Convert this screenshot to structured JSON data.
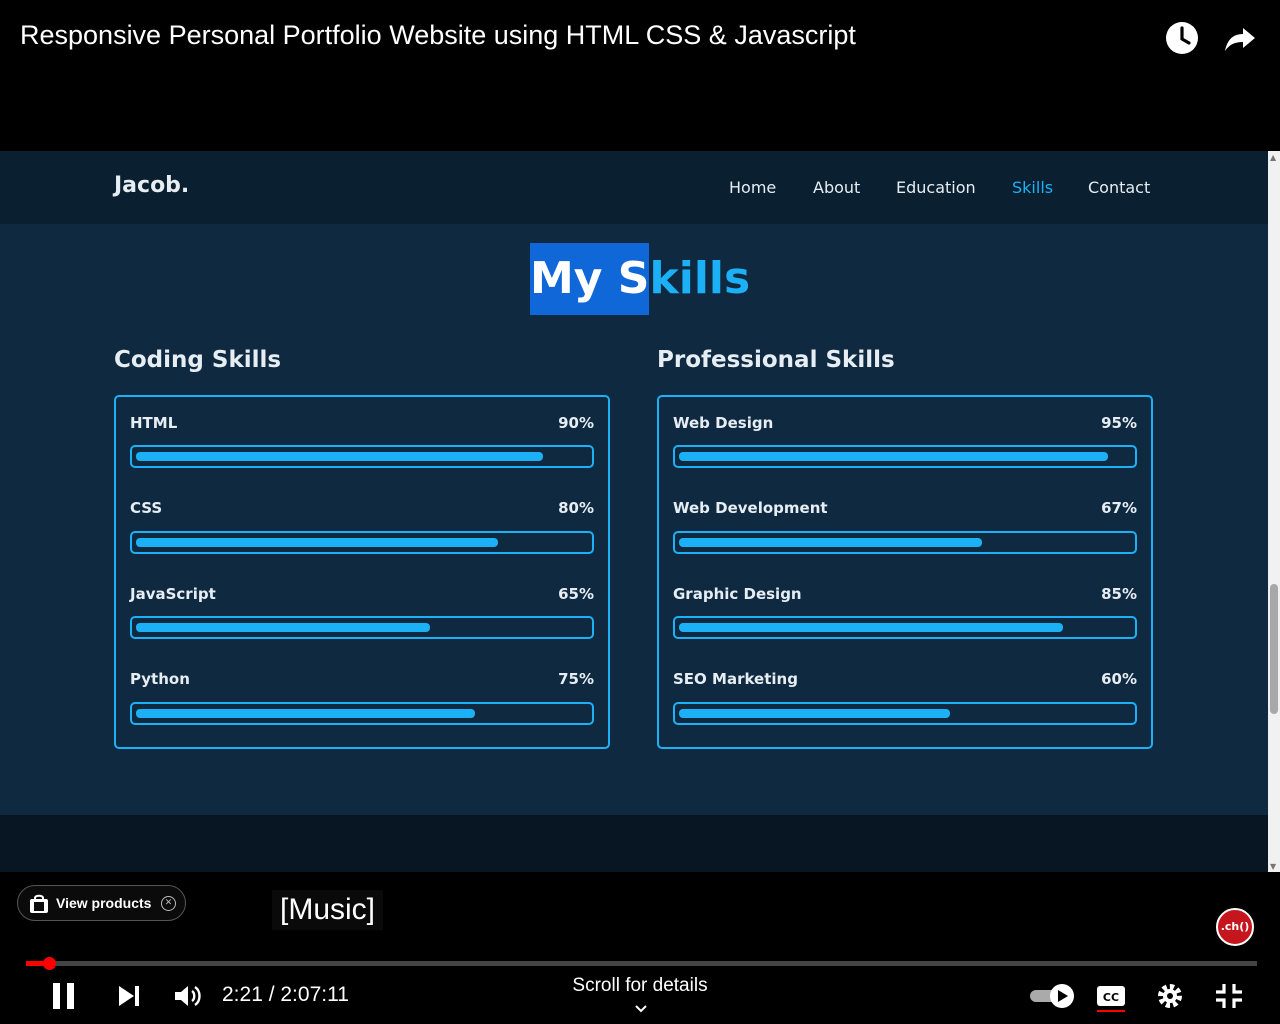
{
  "video": {
    "title": "Responsive Personal Portfolio Website using HTML CSS & Javascript"
  },
  "site": {
    "logo": "Jacob.",
    "nav": [
      {
        "label": "Home",
        "active": false
      },
      {
        "label": "About",
        "active": false
      },
      {
        "label": "Education",
        "active": false
      },
      {
        "label": "Skills",
        "active": true
      },
      {
        "label": "Contact",
        "active": false
      }
    ],
    "heading_selected": "My S",
    "heading_rest": "kills",
    "coding": {
      "title": "Coding Skills",
      "skills": [
        {
          "name": "HTML",
          "percent_label": "90%",
          "percent": 90
        },
        {
          "name": "CSS",
          "percent_label": "80%",
          "percent": 80
        },
        {
          "name": "JavaScript",
          "percent_label": "65%",
          "percent": 65
        },
        {
          "name": "Python",
          "percent_label": "75%",
          "percent": 75
        }
      ]
    },
    "professional": {
      "title": "Professional Skills",
      "skills": [
        {
          "name": "Web Design",
          "percent_label": "95%",
          "percent": 95
        },
        {
          "name": "Web Development",
          "percent_label": "67%",
          "percent": 67
        },
        {
          "name": "Graphic Design",
          "percent_label": "85%",
          "percent": 85
        },
        {
          "name": "SEO Marketing",
          "percent_label": "60%",
          "percent": 60
        }
      ]
    },
    "accent_color": "#1cb0f6",
    "background_color": "#0f2940"
  },
  "player": {
    "view_products_label": "View products",
    "caption": "[Music]",
    "time_display": "2:21 / 2:07:11",
    "progress_fraction": 0.019,
    "scroll_details_label": "Scroll for details",
    "subscribe_badge_text": ".ch()",
    "icons": [
      "clock-icon",
      "share-icon",
      "pause-icon",
      "next-icon",
      "volume-icon",
      "autoplay-toggle-icon",
      "captions-icon",
      "settings-icon",
      "exit-fullscreen-icon"
    ]
  }
}
